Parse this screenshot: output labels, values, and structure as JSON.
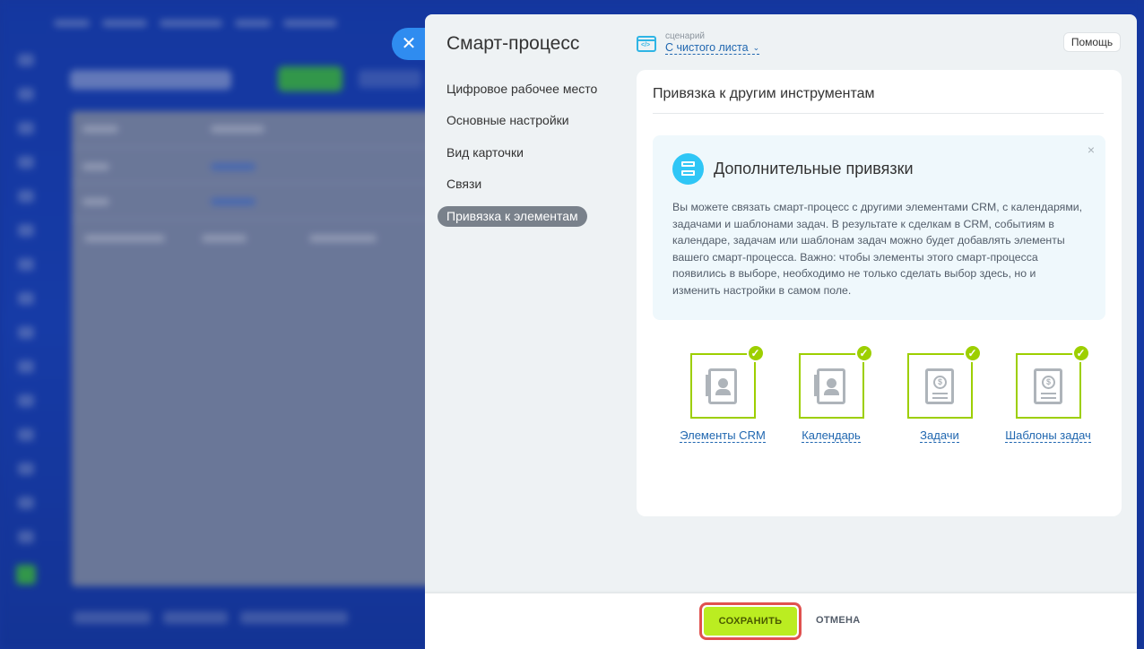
{
  "panel": {
    "title": "Смарт-процесс",
    "scenario_label": "сценарий",
    "scenario_value": "С чистого листа",
    "help_label": "Помощь",
    "close_symbol": "✕"
  },
  "menu": {
    "items": [
      {
        "label": "Цифровое рабочее место"
      },
      {
        "label": "Основные настройки"
      },
      {
        "label": "Вид карточки"
      },
      {
        "label": "Связи"
      },
      {
        "label": "Привязка к элементам"
      }
    ],
    "active_index": 4
  },
  "content": {
    "title": "Привязка к другим инструментам",
    "info": {
      "title": "Дополнительные привязки",
      "text": "Вы можете связать смарт-процесс с другими элементами CRM, с календарями, задачами и шаблонами задач. В результате к сделкам в CRM, событиям в календаре, задачам или шаблонам задач можно будет добавлять элементы вашего смарт-процесса. Важно: чтобы элементы этого смарт-процесса появились в выборе, необходимо не только сделать выбор здесь, но и изменить настройки в самом поле.",
      "close_symbol": "×"
    },
    "tools": [
      {
        "label": "Элементы CRM",
        "checked": true,
        "icon": "contact-book-icon"
      },
      {
        "label": "Календарь",
        "checked": true,
        "icon": "contact-book-icon"
      },
      {
        "label": "Задачи",
        "checked": true,
        "icon": "invoice-icon"
      },
      {
        "label": "Шаблоны задач",
        "checked": true,
        "icon": "invoice-icon"
      }
    ]
  },
  "footer": {
    "save_label": "СОХРАНИТЬ",
    "cancel_label": "ОТМЕНА"
  },
  "colors": {
    "accent_green": "#bbed21",
    "check_green": "#9dcf00",
    "link_blue": "#2067b0",
    "highlight_red": "#e0514f"
  }
}
